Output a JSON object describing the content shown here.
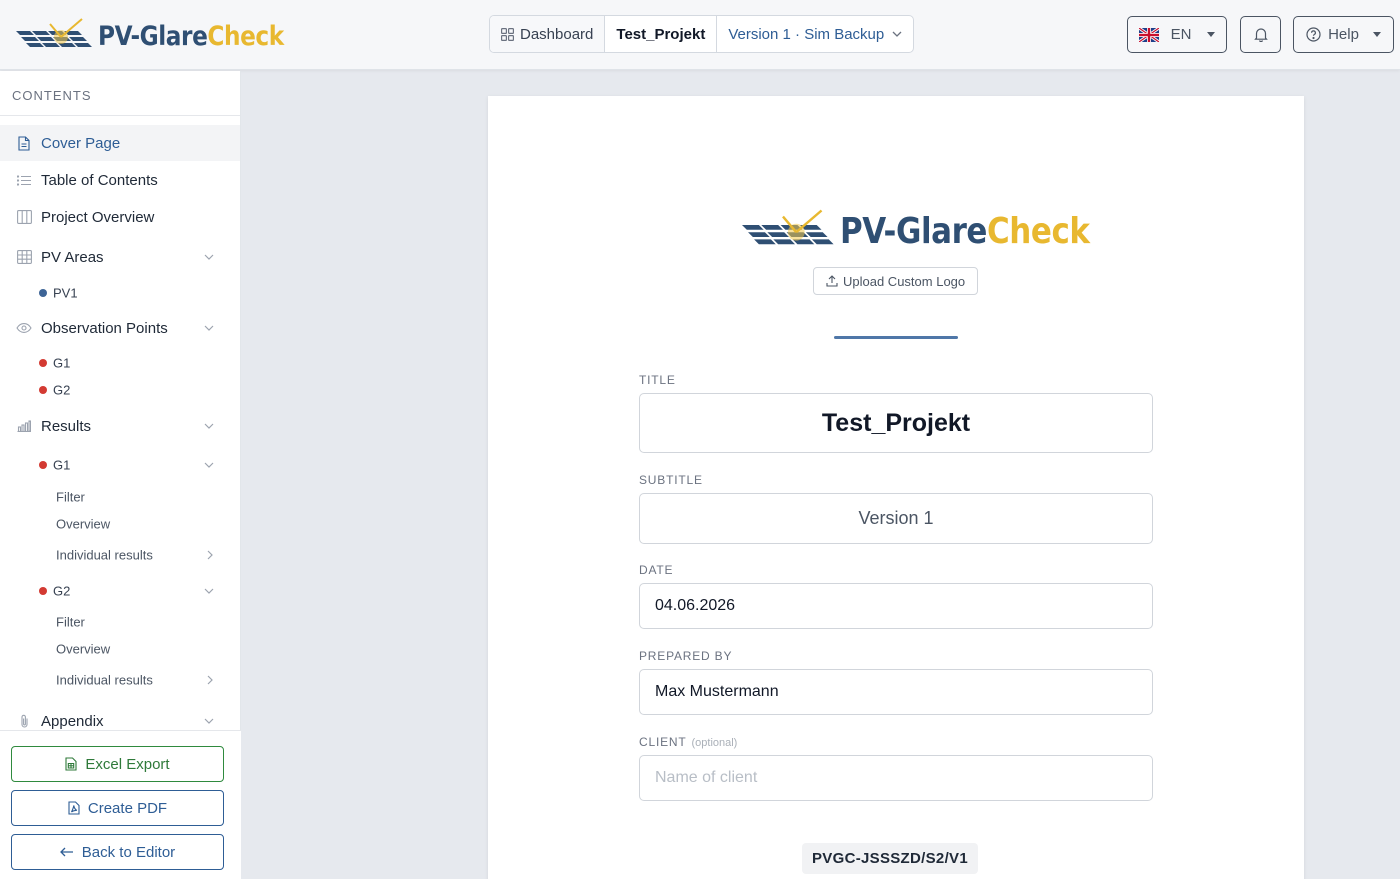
{
  "brand": {
    "part1": "PV-Glare",
    "part2": "Check"
  },
  "breadcrumb": {
    "dashboard": "Dashboard",
    "project": "Test_Projekt",
    "version": "Version 1 · Sim Backup"
  },
  "header": {
    "language": "EN",
    "help": "Help"
  },
  "sidebar": {
    "heading": "CONTENTS",
    "items": {
      "cover": "Cover Page",
      "toc": "Table of Contents",
      "overview": "Project Overview",
      "pv_areas": "PV Areas",
      "pv1": "PV1",
      "observation": "Observation Points",
      "obs_g1": "G1",
      "obs_g2": "G2",
      "results": "Results",
      "res_g1": "G1",
      "res_g1_filter": "Filter",
      "res_g1_overview": "Overview",
      "res_g1_individual": "Individual results",
      "res_g2": "G2",
      "res_g2_filter": "Filter",
      "res_g2_overview": "Overview",
      "res_g2_individual": "Individual results",
      "appendix": "Appendix"
    },
    "actions": {
      "excel": "Excel Export",
      "pdf": "Create PDF",
      "back": "Back to Editor"
    }
  },
  "cover": {
    "upload_logo": "Upload Custom Logo",
    "title_label": "TITLE",
    "title_value": "Test_Projekt",
    "subtitle_label": "SUBTITLE",
    "subtitle_value": "Version 1",
    "date_label": "DATE",
    "date_value": "04.06.2026",
    "prepared_label": "PREPARED BY",
    "prepared_value": "Max Mustermann",
    "client_label": "CLIENT",
    "client_optional": "(optional)",
    "client_placeholder": "Name of client",
    "project_code": "PVGC-JSSSZD/S2/V1"
  },
  "colors": {
    "brand_blue": "#2f4f73",
    "brand_yellow": "#e8b830",
    "accent": "#2e5d95",
    "pv_dot": "#3d6496",
    "obs_dot": "#d33a32",
    "excel_green": "#2f8a3e"
  }
}
